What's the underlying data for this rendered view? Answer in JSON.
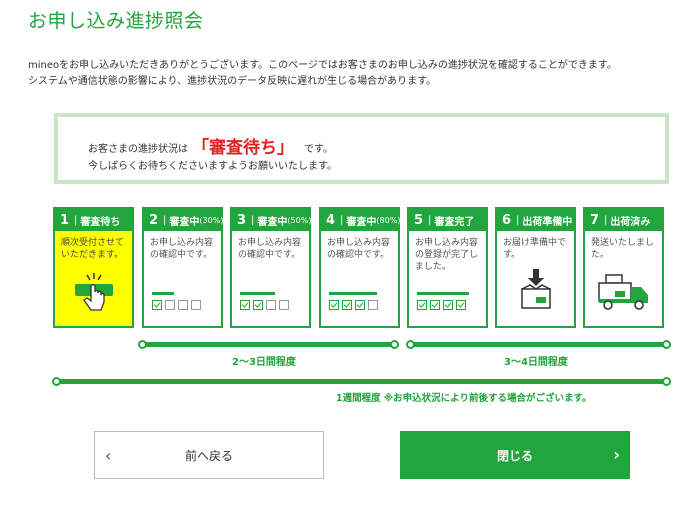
{
  "page": {
    "title": "お申し込み進捗照会",
    "intro_line1": "mineoをお申し込みいただきありがとうございます。このページではお客さまのお申し込みの進捗状況を確認することができます。",
    "intro_line2": "システムや通信状態の影響により、進捗状況のデータ反映に遅れが生じる場合があります。"
  },
  "status": {
    "prefix": "お客さまの進捗状況は",
    "value": "「審査待ち」",
    "suffix": "です。",
    "message": "今しばらくお待ちくださいますようお願いいたします。",
    "value_color": "#e02424"
  },
  "steps": [
    {
      "num": "1",
      "label": "審査待ち",
      "pct": "",
      "desc": "順次受付させていただきます。",
      "active": true,
      "illus": "hand-pointer-icon"
    },
    {
      "num": "2",
      "label": "審査中",
      "pct": "(30%)",
      "desc": "お申し込み内容の確認中です。",
      "active": false,
      "progress": 0.25
    },
    {
      "num": "3",
      "label": "審査中",
      "pct": "(50%)",
      "desc": "お申し込み内容の確認中です。",
      "active": false,
      "progress": 0.5
    },
    {
      "num": "4",
      "label": "審査中",
      "pct": "(80%)",
      "desc": "お申し込み内容の確認中です。",
      "active": false,
      "progress": 0.75
    },
    {
      "num": "5",
      "label": "審査完了",
      "pct": "",
      "desc": "お申し込み内容の登録が完了しました。",
      "active": false,
      "progress": 1.0
    },
    {
      "num": "6",
      "label": "出荷準備中",
      "pct": "",
      "desc": "お届け準備中です。",
      "active": false,
      "illus": "box-icon"
    },
    {
      "num": "7",
      "label": "出荷済み",
      "pct": "",
      "desc": "発送いたしました。",
      "active": false,
      "illus": "truck-icon"
    }
  ],
  "timeline": {
    "review_period": "2〜3日間程度",
    "shipping_period": "3〜4日間程度",
    "total_period": "1週間程度 ※お申込状況により前後する場合がございます。"
  },
  "buttons": {
    "back_label": "前へ戻る",
    "close_label": "閉じる"
  },
  "colors": {
    "brand_green": "#22a53c",
    "active_step": "#ffff00"
  }
}
